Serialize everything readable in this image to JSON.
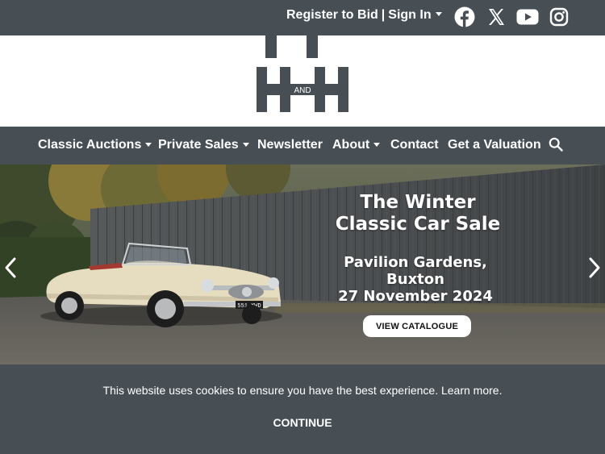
{
  "header": {
    "register_label": "Register to Bid",
    "separator": "|",
    "signin_label": "Sign In",
    "social": [
      "facebook-icon",
      "x-icon",
      "youtube-icon",
      "instagram-icon"
    ]
  },
  "logo": {
    "mark_text": "AND"
  },
  "nav": {
    "items": [
      {
        "label": "Classic Auctions",
        "dropdown": true
      },
      {
        "label": "Private Sales",
        "dropdown": true
      },
      {
        "label": "Newsletter",
        "dropdown": false
      },
      {
        "label": "About",
        "dropdown": true
      },
      {
        "label": "Contact",
        "dropdown": false
      },
      {
        "label": "Get a Valuation",
        "dropdown": false
      }
    ],
    "search_icon": "search-icon"
  },
  "hero": {
    "title_line1": "The Winter",
    "title_line2": "Classic Car Sale",
    "venue": "Pavilion Gardens, Buxton",
    "date": "27 November 2024",
    "cta_label": "VIEW CATALOGUE",
    "plate": "551 XWD"
  },
  "cookie": {
    "message": "This website uses cookies to ensure you have the best experience. Learn more.",
    "continue_label": "CONTINUE"
  },
  "colors": {
    "bar": "#474f55",
    "white": "#ffffff"
  }
}
